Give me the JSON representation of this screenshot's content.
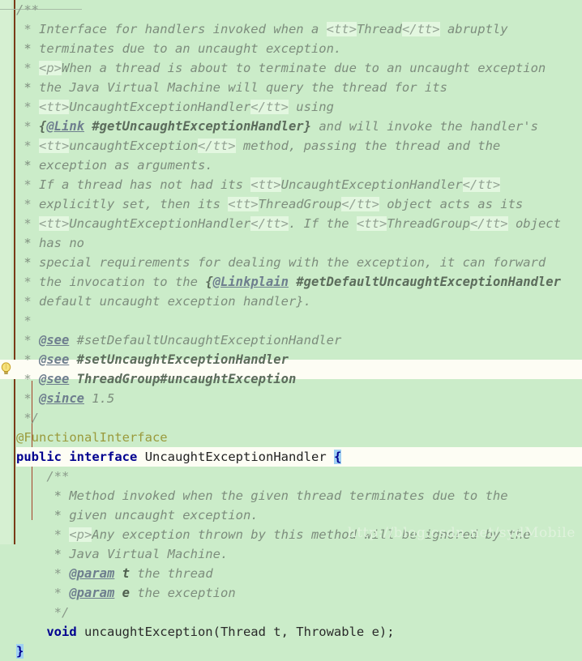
{
  "editor": {
    "language": "java",
    "theme_background": "#cbecc9",
    "gutter_background": "#d6f0d2",
    "current_line_background": "#fdfdf4",
    "bracket_match_background": "#9fd0f2",
    "comment_color": "#8a9a8a",
    "keyword_color": "#00008f",
    "annotation_color": "#9a9a3c",
    "indent_guide_color": "#a4422a"
  },
  "gutter": {
    "bulb_icon": "lightbulb-icon",
    "bulb_line": 19
  },
  "watermark": {
    "text": "http://blog.csdn.net/sydMobile"
  },
  "code": {
    "lines": [
      {
        "n": 1,
        "type": "comment",
        "text": "/**"
      },
      {
        "n": 2,
        "type": "comment",
        "text": " * Interface for handlers invoked when a <tt>Thread</tt> abruptly"
      },
      {
        "n": 3,
        "type": "comment",
        "text": " * terminates due to an uncaught exception."
      },
      {
        "n": 4,
        "type": "comment",
        "text": " * <p>When a thread is about to terminate due to an uncaught exception"
      },
      {
        "n": 5,
        "type": "comment",
        "text": " * the Java Virtual Machine will query the thread for its"
      },
      {
        "n": 6,
        "type": "comment",
        "text": " * <tt>UncaughtExceptionHandler</tt> using"
      },
      {
        "n": 7,
        "type": "comment",
        "text": " * {@Link #getUncaughtExceptionHandler} and will invoke the handler's"
      },
      {
        "n": 8,
        "type": "comment",
        "text": " * <tt>uncaughtException</tt> method, passing the thread and the"
      },
      {
        "n": 9,
        "type": "comment",
        "text": " * exception as arguments."
      },
      {
        "n": 10,
        "type": "comment",
        "text": " * If a thread has not had its <tt>UncaughtExceptionHandler</tt>"
      },
      {
        "n": 11,
        "type": "comment",
        "text": " * explicitly set, then its <tt>ThreadGroup</tt> object acts as its"
      },
      {
        "n": 12,
        "type": "comment",
        "text": " * <tt>UncaughtExceptionHandler</tt>. If the <tt>ThreadGroup</tt> object"
      },
      {
        "n": 13,
        "type": "comment",
        "text": " * has no"
      },
      {
        "n": 14,
        "type": "comment",
        "text": " * special requirements for dealing with the exception, it can forward"
      },
      {
        "n": 15,
        "type": "comment",
        "text": " * the invocation to the {@Linkplain #getDefaultUncaughtExceptionHandler"
      },
      {
        "n": 16,
        "type": "comment",
        "text": " * default uncaught exception handler}."
      },
      {
        "n": 17,
        "type": "comment",
        "text": " *"
      },
      {
        "n": 18,
        "type": "comment",
        "text": " * @see #setDefaultUncaughtExceptionHandler"
      },
      {
        "n": 19,
        "type": "comment",
        "text": " * @see #setUncaughtExceptionHandler"
      },
      {
        "n": 20,
        "type": "comment",
        "text": " * @see ThreadGroup#uncaughtException"
      },
      {
        "n": 21,
        "type": "comment",
        "text": " * @since 1.5"
      },
      {
        "n": 22,
        "type": "comment",
        "text": " */"
      },
      {
        "n": 23,
        "type": "annotation",
        "text": "@FunctionalInterface"
      },
      {
        "n": 24,
        "type": "declaration",
        "text": "public interface UncaughtExceptionHandler {"
      },
      {
        "n": 25,
        "type": "comment",
        "text": "    /**"
      },
      {
        "n": 26,
        "type": "comment",
        "text": "     * Method invoked when the given thread terminates due to the"
      },
      {
        "n": 27,
        "type": "comment",
        "text": "     * given uncaught exception."
      },
      {
        "n": 28,
        "type": "comment",
        "text": "     * <p>Any exception thrown by this method will be ignored by the"
      },
      {
        "n": 29,
        "type": "comment",
        "text": "     * Java Virtual Machine."
      },
      {
        "n": 30,
        "type": "comment",
        "text": "     * @param t the thread"
      },
      {
        "n": 31,
        "type": "comment",
        "text": "     * @param e the exception"
      },
      {
        "n": 32,
        "type": "comment",
        "text": "     */"
      },
      {
        "n": 33,
        "type": "code",
        "text": "    void uncaughtException(Thread t, Throwable e);"
      },
      {
        "n": 34,
        "type": "code",
        "text": "}"
      }
    ],
    "tokens": {
      "l1": "/**",
      "l2_star": " * ",
      "l2_a": "Interface for handlers invoked when a ",
      "l2_tag": "<tt>",
      "l2_b": "Thread",
      "l2_tag2": "</tt>",
      "l2_c": " abruptly",
      "l3": " * terminates due to an uncaught exception.",
      "l4_star": " * ",
      "l4_tag": "<p>",
      "l4_rest": "When a thread is about to terminate due to an uncaught exception",
      "l5": " * the Java Virtual Machine will query the thread for its",
      "l6_star": " * ",
      "l6_tag": "<tt>",
      "l6_txt": "UncaughtExceptionHandler",
      "l6_tag2": "</tt>",
      "l6_rest": " using",
      "l7_star": " * ",
      "l7_brace": "{",
      "l7_tag": "@Link",
      "l7_ref": " #getUncaughtExceptionHandler",
      "l7_close": "}",
      "l7_rest": " and will invoke the handler's",
      "l8_star": " * ",
      "l8_tag": "<tt>",
      "l8_txt": "uncaughtException",
      "l8_tag2": "</tt>",
      "l8_rest": " method, passing the thread and the",
      "l9": " * exception as arguments.",
      "l10_star": " * ",
      "l10_a": "If a thread has not had its ",
      "l10_tag": "<tt>",
      "l10_txt": "UncaughtExceptionHandler",
      "l10_tag2": "</tt>",
      "l11_star": " * ",
      "l11_a": "explicitly set, then its ",
      "l11_tag": "<tt>",
      "l11_txt": "ThreadGroup",
      "l11_tag2": "</tt>",
      "l11_b": " object acts as its",
      "l12_star": " * ",
      "l12_tag": "<tt>",
      "l12_txt": "UncaughtExceptionHandler",
      "l12_tag2": "</tt>",
      "l12_a": ". If the ",
      "l12_tag3": "<tt>",
      "l12_txt2": "ThreadGroup",
      "l12_tag4": "</tt>",
      "l12_b": " object",
      "l13": " * has no",
      "l14": " * special requirements for dealing with the exception, it can forward",
      "l15_star": " * ",
      "l15_a": "the invocation to the ",
      "l15_brace": "{",
      "l15_tag": "@Linkplain",
      "l15_ref": " #getDefaultUncaughtExceptionHandler",
      "l16_star": " * ",
      "l16_a": "default uncaught exception handler",
      "l16_close": "}.",
      "l17": " *",
      "l18_star": " * ",
      "l18_tag": "@see",
      "l18_ref": " #setDefaultUncaughtExceptionHandler",
      "l19_star": " * ",
      "l19_tag": "@see",
      "l19_ref": " #setUncaughtExceptionHandler",
      "l20_star": " * ",
      "l20_tag": "@see",
      "l20_ref": " ThreadGroup#uncaughtException",
      "l21_star": " * ",
      "l21_tag": "@since",
      "l21_ver": " 1.5",
      "l22": " */",
      "l23": "@FunctionalInterface",
      "l24_kw1": "public",
      "l24_sp1": " ",
      "l24_kw2": "interface",
      "l24_sp2": " ",
      "l24_name": "UncaughtExceptionHandler",
      "l24_sp3": " ",
      "l24_brace": "{",
      "l25": "    /**",
      "l26": "     * Method invoked when the given thread terminates due to the",
      "l27": "     * given uncaught exception.",
      "l28_star": "     * ",
      "l28_tag": "<p>",
      "l28_rest": "Any exception thrown by this method will be ignored by the",
      "l29": "     * Java Virtual Machine.",
      "l30_star": "     * ",
      "l30_tag": "@param",
      "l30_sp": " ",
      "l30_p": "t",
      "l30_rest": " the thread",
      "l31_star": "     * ",
      "l31_tag": "@param",
      "l31_sp": " ",
      "l31_p": "e",
      "l31_rest": " the exception",
      "l32": "     */",
      "l33_indent": "    ",
      "l33_kw": "void",
      "l33_rest": " uncaughtException(Thread t, Throwable e);",
      "l34_brace": "}"
    }
  }
}
